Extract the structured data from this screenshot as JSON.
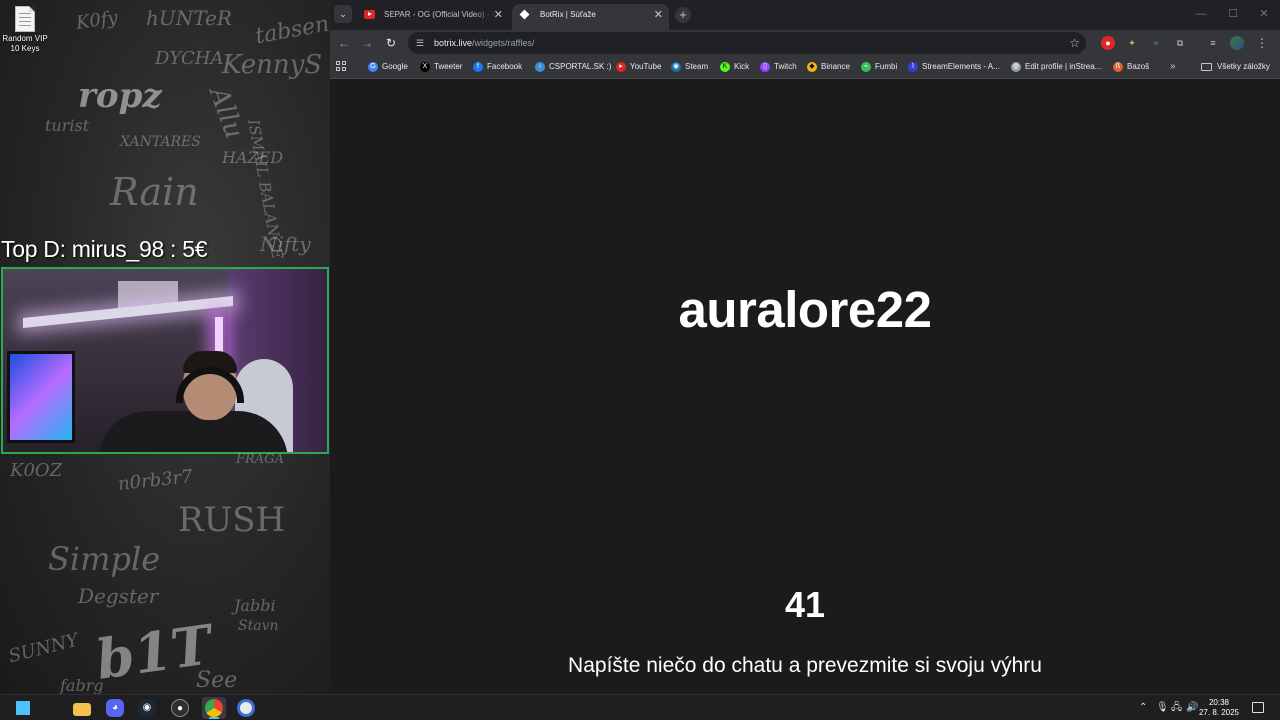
{
  "overlay": {
    "desktop_icon": {
      "label": "Random VIP 10 Keys"
    },
    "top_donation": "Top D: mirus_98 : 5€",
    "graffiti": [
      "K0fy",
      "hUNTeR",
      "tabsen",
      "KennyS",
      "ropz",
      "DYCHA",
      "Allu",
      "turist",
      "XANTARES",
      "ISMAIL BALANCE",
      "Rain",
      "HAZED",
      "Nifty",
      "K0OZ",
      "n0rb3r7",
      "FRAGA",
      "RUSH",
      "Simple",
      "Degster",
      "Jabbi",
      "Stavn",
      "b1T",
      "SUNNY",
      "fabrg",
      "See"
    ]
  },
  "browser": {
    "tabs": [
      {
        "label": "SEPAR - OG (Official Video) - Yo",
        "active": false
      },
      {
        "label": "BotRix | Súťaže",
        "active": true
      }
    ],
    "url": {
      "host": "botrix.live",
      "path": "/widgets/raffles/"
    },
    "bookmarks": [
      {
        "label": "Google",
        "icon": "google-icon",
        "color": "#4285f4"
      },
      {
        "label": "Tweeter",
        "icon": "x-icon",
        "color": "#000000"
      },
      {
        "label": "Facebook",
        "icon": "facebook-icon",
        "color": "#1877f2"
      },
      {
        "label": "CSPORTAL.SK :)",
        "icon": "csportal-icon",
        "color": "#3c8fd6"
      },
      {
        "label": "YouTube",
        "icon": "youtube-icon",
        "color": "#e02525"
      },
      {
        "label": "Steam",
        "icon": "steam-icon",
        "color": "#1b6fa8"
      },
      {
        "label": "Kick",
        "icon": "kick-icon",
        "color": "#53fc18"
      },
      {
        "label": "Twitch",
        "icon": "twitch-icon",
        "color": "#9146ff"
      },
      {
        "label": "Binance",
        "icon": "binance-icon",
        "color": "#f0b90b"
      },
      {
        "label": "Fumbi",
        "icon": "fumbi-icon",
        "color": "#36c05a"
      },
      {
        "label": "StreamElements - A...",
        "icon": "streamelements-icon",
        "color": "#3b3bd6"
      },
      {
        "label": "Edit profile | inStrea...",
        "icon": "globe-icon",
        "color": "#9aa0a6"
      },
      {
        "label": "Bazoš",
        "icon": "bazos-icon",
        "color": "#e06030"
      }
    ],
    "all_bookmarks_label": "Všetky záložky"
  },
  "raffle": {
    "winner": "auralore22",
    "countdown": "41",
    "instructions": "Napíšte niečo do chatu a prevezmite si svoju výhru"
  },
  "taskbar": {
    "apps": [
      "windows-start",
      "file-explorer",
      "discord",
      "steam",
      "obs-studio",
      "chrome",
      "chrome-alt"
    ],
    "time": "20:38",
    "date": "27. 8. 2025"
  },
  "colors": {
    "cam_border": "#2ea84e",
    "accent": "#4cc2ff"
  }
}
